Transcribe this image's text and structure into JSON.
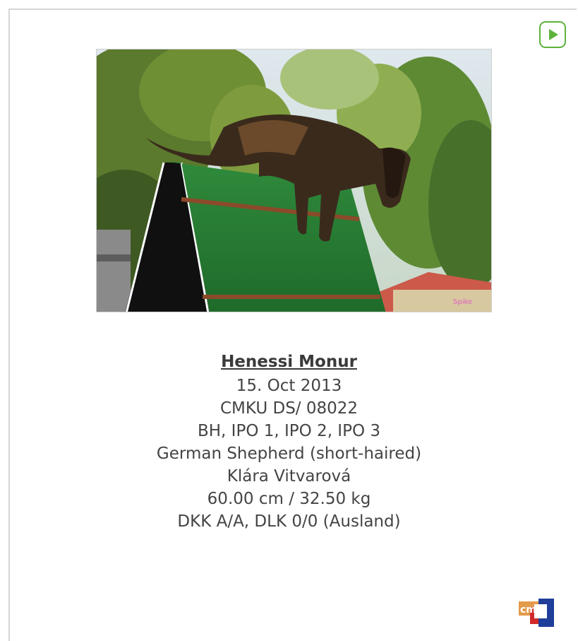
{
  "dog": {
    "name": "Henessi Monur",
    "birth_date": "15. Oct 2013",
    "registration": "CMKU DS/ 08022",
    "titles": "BH, IPO 1, IPO 2, IPO 3",
    "breed": "German Shepherd (short-haired)",
    "owner": "Klára Vitvarová",
    "measurements": "60.00 cm / 32.50 kg",
    "health": "DKK A/A, DLK 0/0 (Ausland)"
  },
  "icons": {
    "play": "play-icon",
    "logo": "cm-logo-icon"
  },
  "colors": {
    "accent": "#5db33a",
    "text": "#444444"
  }
}
